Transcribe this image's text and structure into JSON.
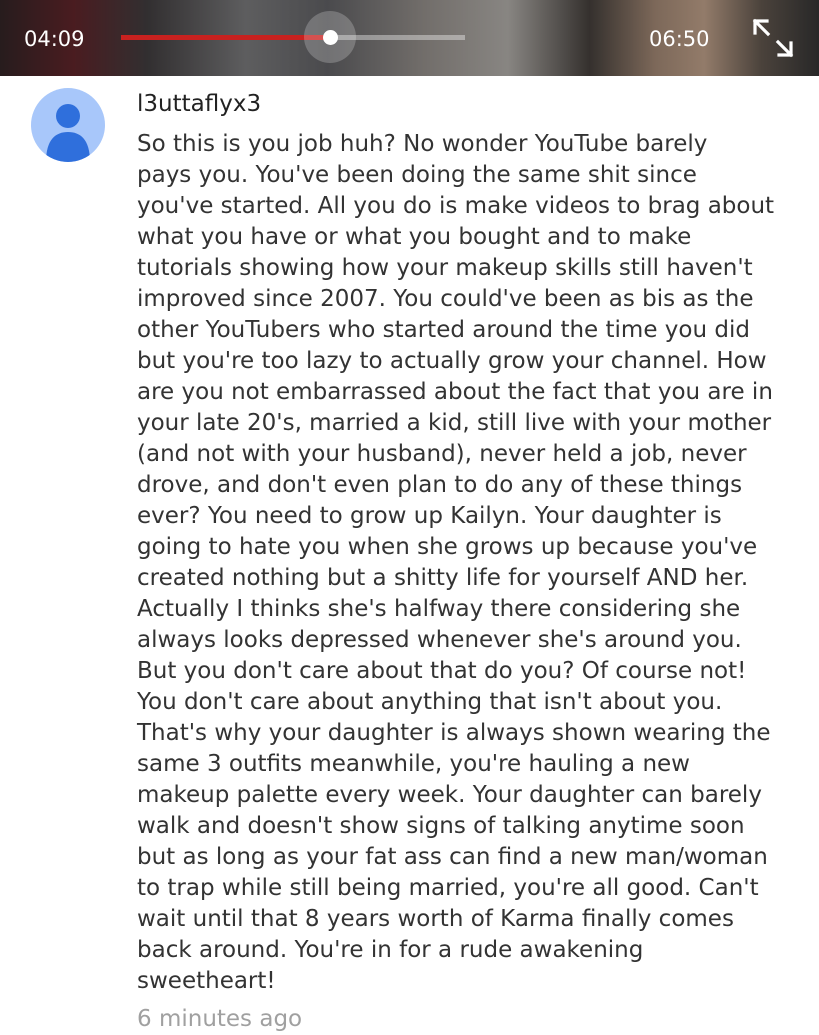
{
  "player": {
    "elapsed": "04:09",
    "duration": "06:50",
    "progress": 0.608,
    "accent_color": "#c8211f",
    "fullscreen_icon": "fullscreen-icon"
  },
  "comment": {
    "avatar_icon": "default-user-avatar",
    "author": "l3uttaflyx3",
    "lines": [
      "So this is you job huh? No wonder YouTube barely",
      "pays you. You've been doing the same shit since",
      "you've started. All you do is make videos to brag about",
      "what you have or what you bought and to make",
      "tutorials showing how your makeup skills still haven't",
      "improved since 2007. You could've been as bis as the",
      "other YouTubers who started around the time you did",
      "but you're too lazy to actually grow your channel. How",
      "are you not embarrassed about the fact that you are in",
      "your late 20's, married a kid, still live with your mother",
      "(and not with your husband), never held a job, never",
      "drove, and don't even plan to do any of these things",
      "ever? You need to grow up Kailyn. Your daughter is",
      "going to hate you when she grows up because you've",
      "created nothing but a shitty life for yourself AND her.",
      "Actually I thinks she's halfway there considering she",
      "always looks depressed whenever she's around you.",
      "But you don't care about that do you? Of course not!",
      "You don't care about anything that isn't about you.",
      "That's why your daughter is always shown wearing the",
      "same 3 outfits meanwhile, you're hauling a new",
      "makeup palette every week. Your daughter can barely",
      "walk and doesn't show signs of talking anytime soon",
      "but as long as your fat ass can find a new man/woman",
      "to trap while still being married, you're all good. Can't",
      "wait until that 8 years worth of Karma finally comes",
      "back around. You're in for a rude awakening",
      "sweetheart!"
    ],
    "timestamp": "6 minutes ago"
  }
}
